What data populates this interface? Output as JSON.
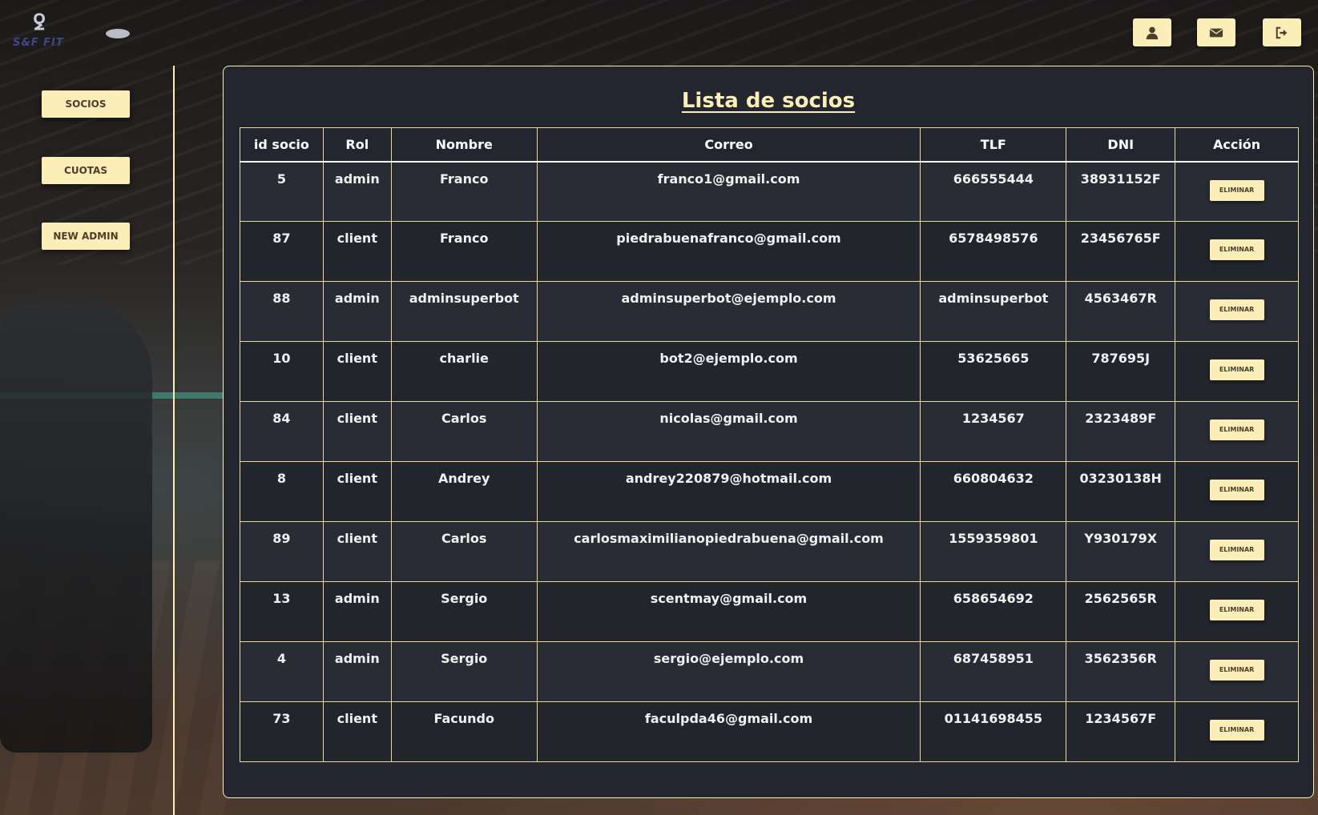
{
  "brand": {
    "logo_text": "S&F FIT"
  },
  "topbar": {
    "buttons": [
      {
        "icon": "user-icon"
      },
      {
        "icon": "envelope-icon"
      },
      {
        "icon": "sign-out-icon"
      }
    ]
  },
  "sidebar": {
    "items": [
      {
        "label": "SOCIOS"
      },
      {
        "label": "CUOTAS"
      },
      {
        "label": "NEW ADMIN"
      }
    ]
  },
  "main": {
    "title": "Lista de socios",
    "columns": [
      "id socio",
      "Rol",
      "Nombre",
      "Correo",
      "TLF",
      "DNI",
      "Acción"
    ],
    "delete_label": "ELIMINAR",
    "rows": [
      {
        "id": "5",
        "rol": "admin",
        "nombre": "Franco",
        "correo": "franco1@gmail.com",
        "tlf": "666555444",
        "dni": "38931152F"
      },
      {
        "id": "87",
        "rol": "client",
        "nombre": "Franco",
        "correo": "piedrabuenafranco@gmail.com",
        "tlf": "6578498576",
        "dni": "23456765F"
      },
      {
        "id": "88",
        "rol": "admin",
        "nombre": "adminsuperbot",
        "correo": "adminsuperbot@ejemplo.com",
        "tlf": "adminsuperbot",
        "dni": "4563467R"
      },
      {
        "id": "10",
        "rol": "client",
        "nombre": "charlie",
        "correo": "bot2@ejemplo.com",
        "tlf": "53625665",
        "dni": "787695J"
      },
      {
        "id": "84",
        "rol": "client",
        "nombre": "Carlos",
        "correo": "nicolas@gmail.com",
        "tlf": "1234567",
        "dni": "2323489F"
      },
      {
        "id": "8",
        "rol": "client",
        "nombre": "Andrey",
        "correo": "andrey220879@hotmail.com",
        "tlf": "660804632",
        "dni": "03230138H"
      },
      {
        "id": "89",
        "rol": "client",
        "nombre": "Carlos",
        "correo": "carlosmaximilianopiedrabuena@gmail.com",
        "tlf": "1559359801",
        "dni": "Y930179X"
      },
      {
        "id": "13",
        "rol": "admin",
        "nombre": "Sergio",
        "correo": "scentmay@gmail.com",
        "tlf": "658654692",
        "dni": "2562565R"
      },
      {
        "id": "4",
        "rol": "admin",
        "nombre": "Sergio",
        "correo": "sergio@ejemplo.com",
        "tlf": "687458951",
        "dni": "3562356R"
      },
      {
        "id": "73",
        "rol": "client",
        "nombre": "Facundo",
        "correo": "faculpda46@gmail.com",
        "tlf": "01141698455",
        "dni": "1234567F"
      }
    ]
  },
  "colors": {
    "accent": "#fbeeb8",
    "panel": "#24262f",
    "button_text": "#4a3f2a"
  }
}
